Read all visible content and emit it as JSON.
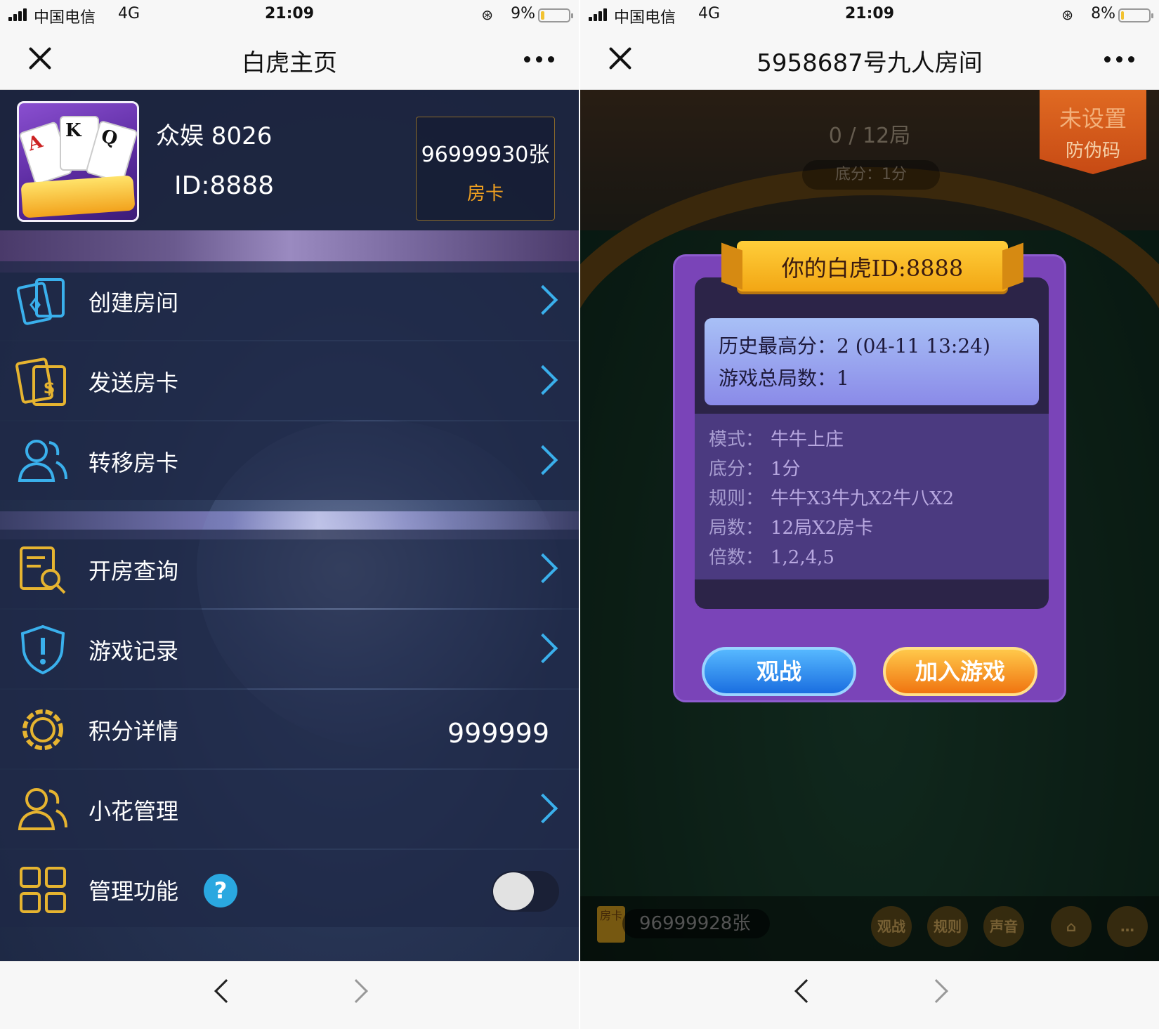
{
  "left": {
    "status": {
      "carrier": "中国电信",
      "network": "4G",
      "time": "21:09",
      "battery": "9%"
    },
    "nav": {
      "title": "白虎主页"
    },
    "profile": {
      "name": "众娱 8026",
      "id": "ID:8888",
      "card_count": "96999930张",
      "card_label": "房卡",
      "avatar": {
        "cards": [
          "A",
          "K",
          "Q"
        ]
      }
    },
    "menu": [
      {
        "label": "创建房间",
        "icon": "cards-icon"
      },
      {
        "label": "发送房卡",
        "icon": "send-card-icon"
      },
      {
        "label": "转移房卡",
        "icon": "users-icon"
      },
      {
        "label": "开房查询",
        "icon": "search-doc-icon"
      },
      {
        "label": "游戏记录",
        "icon": "shield-alert-icon"
      },
      {
        "label": "积分详情",
        "icon": "gear-icon",
        "value": "999999"
      },
      {
        "label": "小花管理",
        "icon": "users-icon"
      },
      {
        "label": "管理功能",
        "icon": "grid-icon",
        "help": "?"
      }
    ]
  },
  "right": {
    "status": {
      "carrier": "中国电信",
      "network": "4G",
      "time": "21:09",
      "battery": "8%"
    },
    "nav": {
      "title": "5958687号九人房间"
    },
    "game": {
      "round": "0 / 12局",
      "base": "底分：1分",
      "badge_line1": "未设置",
      "badge_line2": "防伪码"
    },
    "dialog": {
      "title": "你的白虎ID:8888",
      "stats": [
        "历史最高分：2 (04-11 13:24)",
        "游戏总局数：1"
      ],
      "details": [
        {
          "key": "模式：",
          "value": "牛牛上庄"
        },
        {
          "key": "底分：",
          "value": "1分"
        },
        {
          "key": "规则：",
          "value": "牛牛X3牛九X2牛八X2"
        },
        {
          "key": "局数：",
          "value": "12局X2房卡"
        },
        {
          "key": "倍数：",
          "value": "1,2,4,5"
        }
      ],
      "watch_label": "观战",
      "join_label": "加入游戏"
    },
    "hud": {
      "card_icon_text": "房卡",
      "card_count": "96999928张",
      "buttons": [
        "观战",
        "规则",
        "声音"
      ]
    }
  }
}
